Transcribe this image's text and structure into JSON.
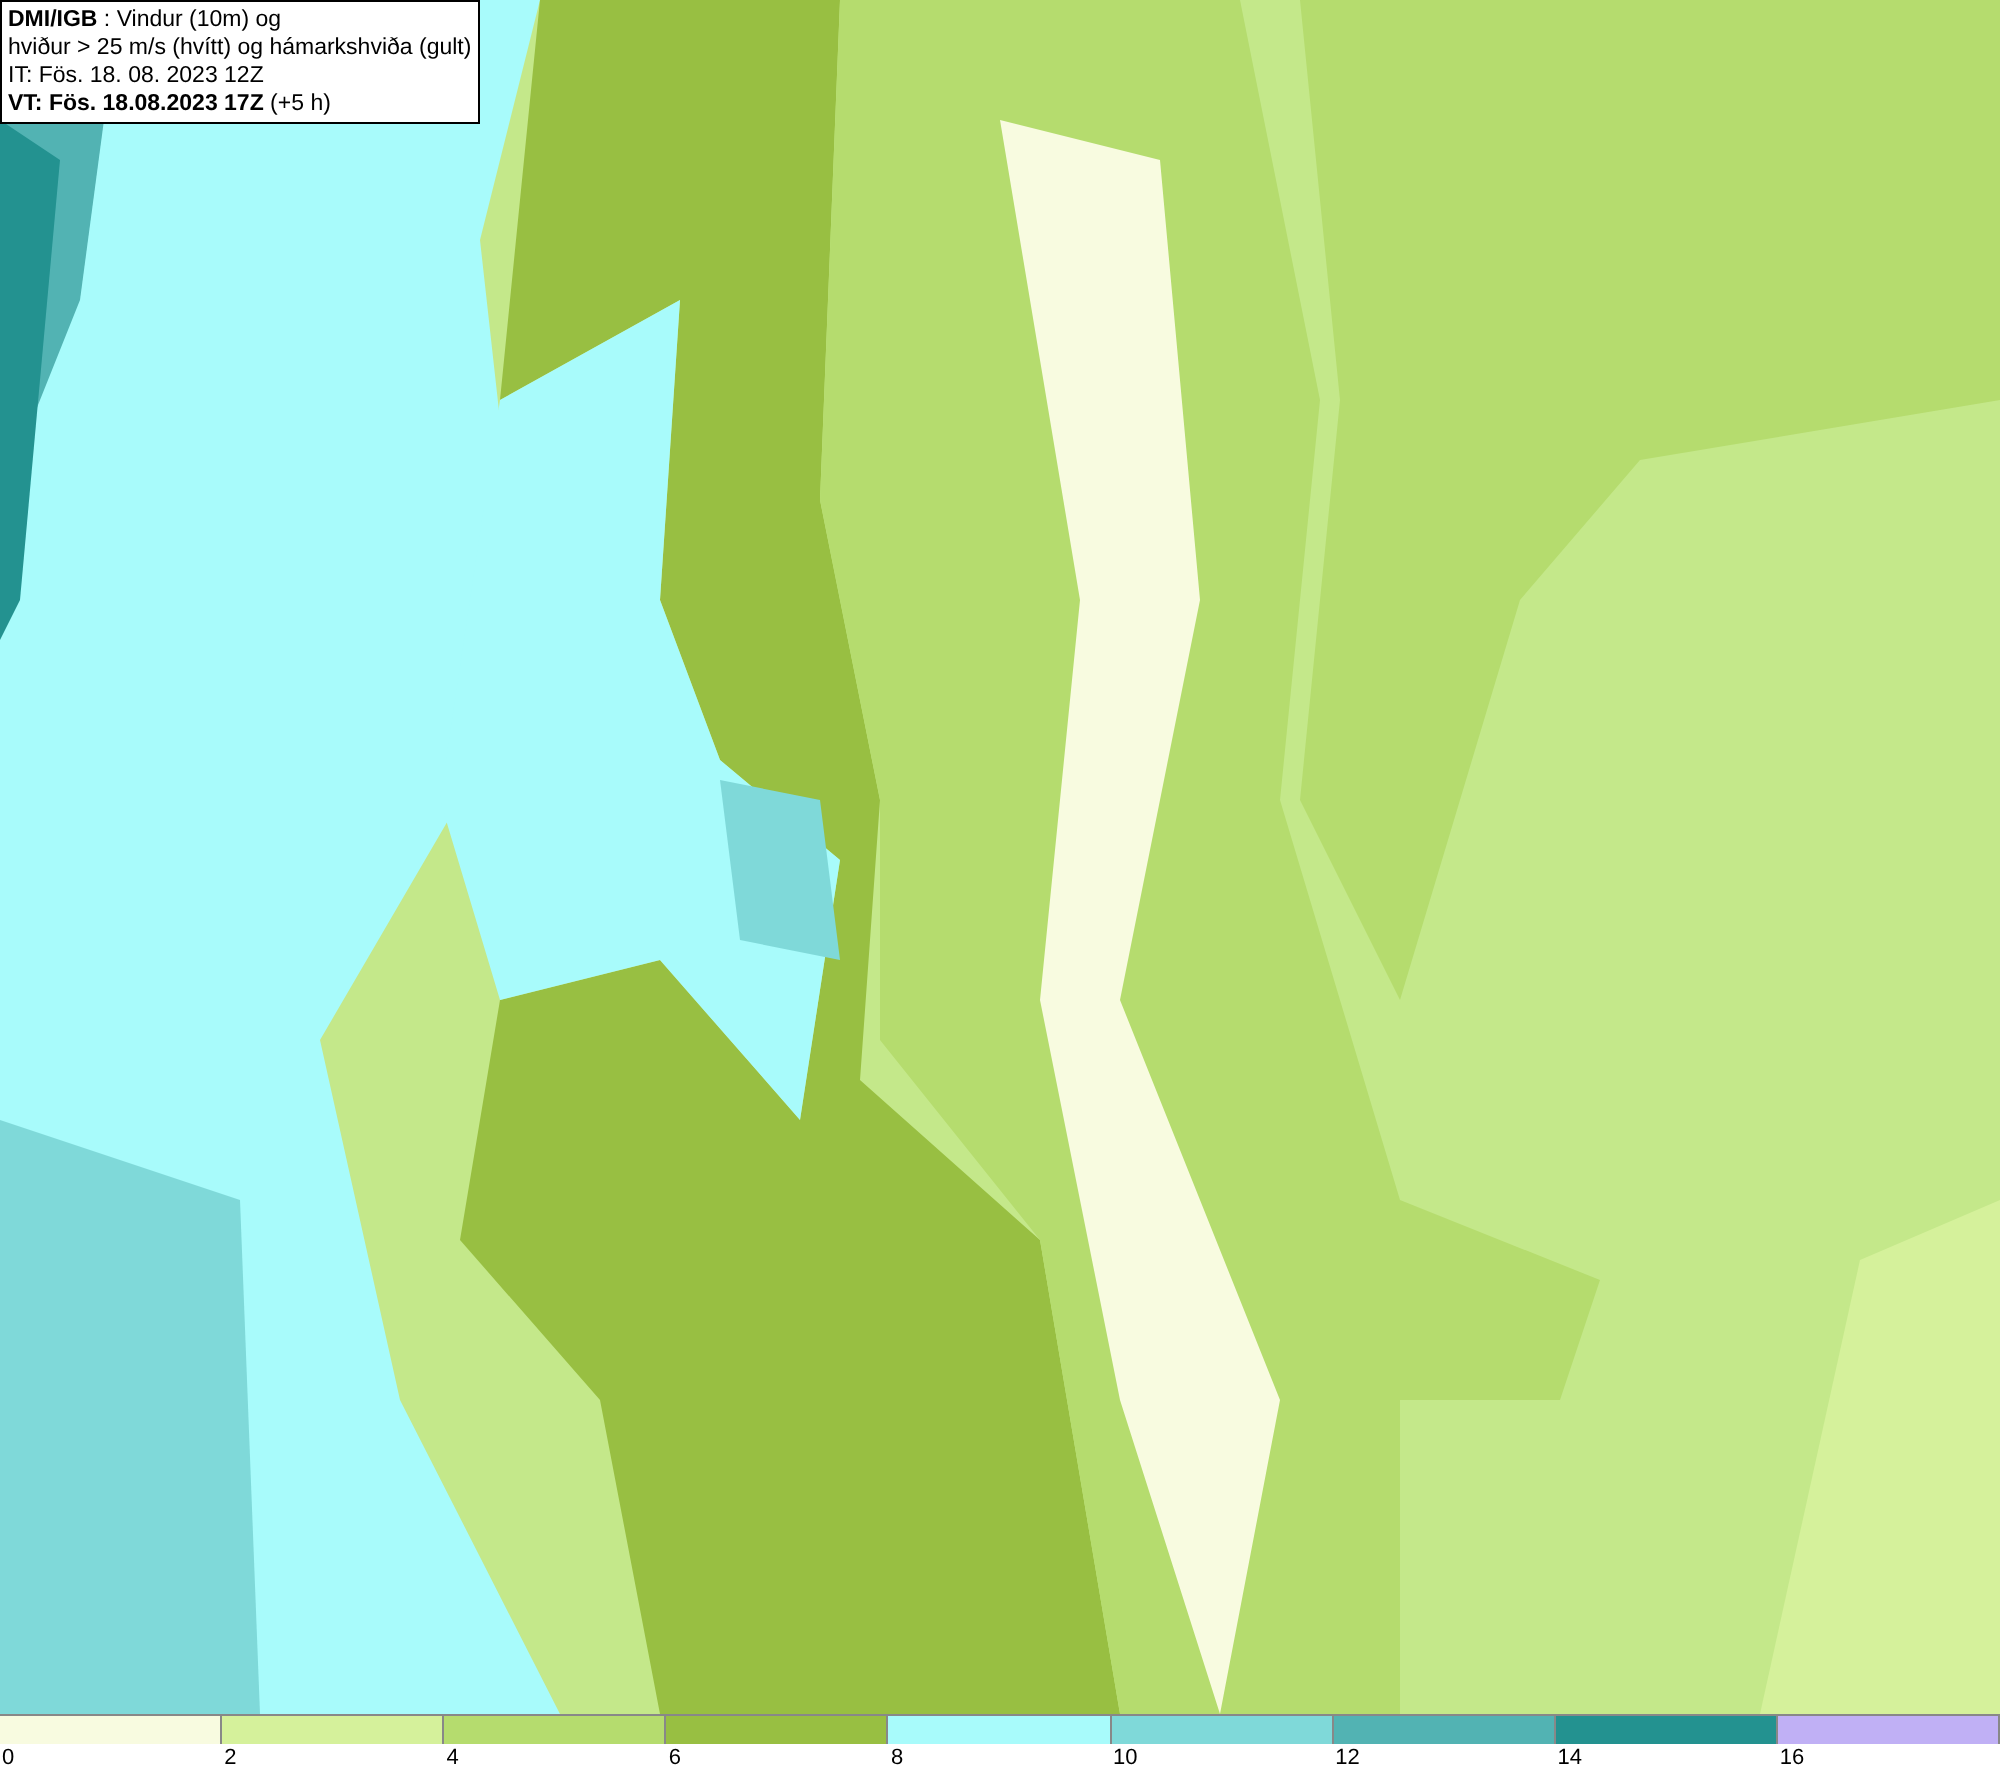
{
  "header": {
    "lines": [
      "**DMI/IGB** : Vindur (10m) og",
      "hviður > 25 m/s (hvítt) og hámarkshviða (gult)",
      "IT: Fös. 18. 08. 2023 12Z",
      "**VT: Fös. 18.08.2023 17Z** (+5 h)"
    ]
  },
  "legend": [
    {
      "label": "0",
      "color": "#f8fbe0"
    },
    {
      "label": "2",
      "color": "#d5f19b"
    },
    {
      "label": "4",
      "color": "#b5dc6e"
    },
    {
      "label": "6",
      "color": "#98bf42"
    },
    {
      "label": "8",
      "color": "#a8fbfb"
    },
    {
      "label": "10",
      "color": "#7fd9d9"
    },
    {
      "label": "12",
      "color": "#52b3b3"
    },
    {
      "label": "14",
      "color": "#239290"
    },
    {
      "label": "16",
      "color": "#c0b0f5"
    }
  ]
}
